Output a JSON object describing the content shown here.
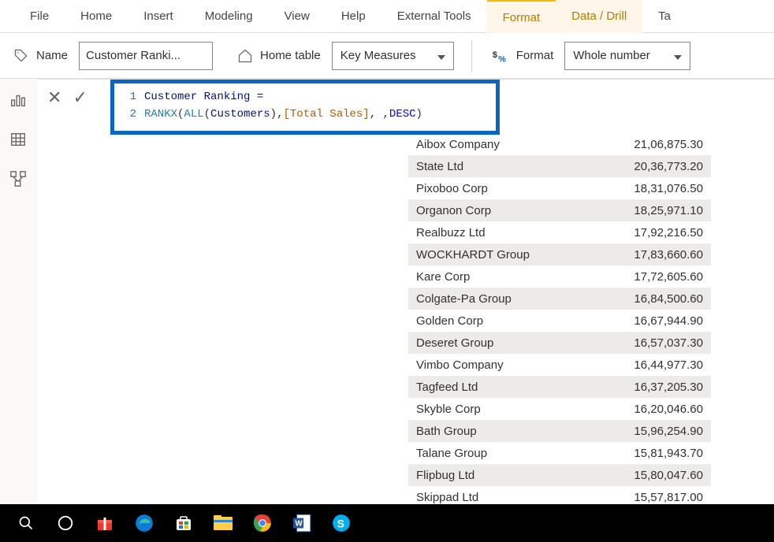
{
  "ribbon": {
    "tabs": [
      "File",
      "Home",
      "Insert",
      "Modeling",
      "View",
      "Help",
      "External Tools",
      "Format",
      "Data / Drill",
      "Ta"
    ]
  },
  "props": {
    "name_label": "Name",
    "name_value": "Customer Ranki...",
    "home_table_label": "Home table",
    "home_table_value": "Key Measures",
    "format_label": "Format",
    "format_value": "Whole number"
  },
  "formula": {
    "line1": {
      "num": "1",
      "text": "Customer Ranking ="
    },
    "line2": {
      "num": "2",
      "p1": "RANKX",
      "p2": "(",
      "p3": " ",
      "p4": "ALL",
      "p5": "(",
      "p6": " Customers ",
      "p7": ")",
      "p8": " , ",
      "p9": "[Total Sales]",
      "p10": " , , ",
      "p11": "DESC",
      "p12": " )"
    }
  },
  "data": [
    {
      "name": "Aibox Company",
      "value": "21,06,875.30"
    },
    {
      "name": "State Ltd",
      "value": "20,36,773.20"
    },
    {
      "name": "Pixoboo Corp",
      "value": "18,31,076.50"
    },
    {
      "name": "Organon Corp",
      "value": "18,25,971.10"
    },
    {
      "name": "Realbuzz Ltd",
      "value": "17,92,216.50"
    },
    {
      "name": "WOCKHARDT Group",
      "value": "17,83,660.60"
    },
    {
      "name": "Kare Corp",
      "value": "17,72,605.60"
    },
    {
      "name": "Colgate-Pa Group",
      "value": "16,84,500.60"
    },
    {
      "name": "Golden Corp",
      "value": "16,67,944.90"
    },
    {
      "name": "Deseret Group",
      "value": "16,57,037.30"
    },
    {
      "name": "Vimbo Company",
      "value": "16,44,977.30"
    },
    {
      "name": "Tagfeed Ltd",
      "value": "16,37,205.30"
    },
    {
      "name": "Skyble Corp",
      "value": "16,20,046.60"
    },
    {
      "name": "Bath Group",
      "value": "15,96,254.90"
    },
    {
      "name": "Talane Group",
      "value": "15,81,943.70"
    },
    {
      "name": "Flipbug Ltd",
      "value": "15,80,047.60"
    },
    {
      "name": "Skippad Ltd",
      "value": "15,57,817.00"
    }
  ],
  "taskbar": {
    "items": [
      "search-icon",
      "cortana-icon",
      "gift-icon",
      "edge-icon",
      "store-icon",
      "explorer-icon",
      "chrome-icon",
      "word-icon",
      "skype-icon"
    ]
  }
}
